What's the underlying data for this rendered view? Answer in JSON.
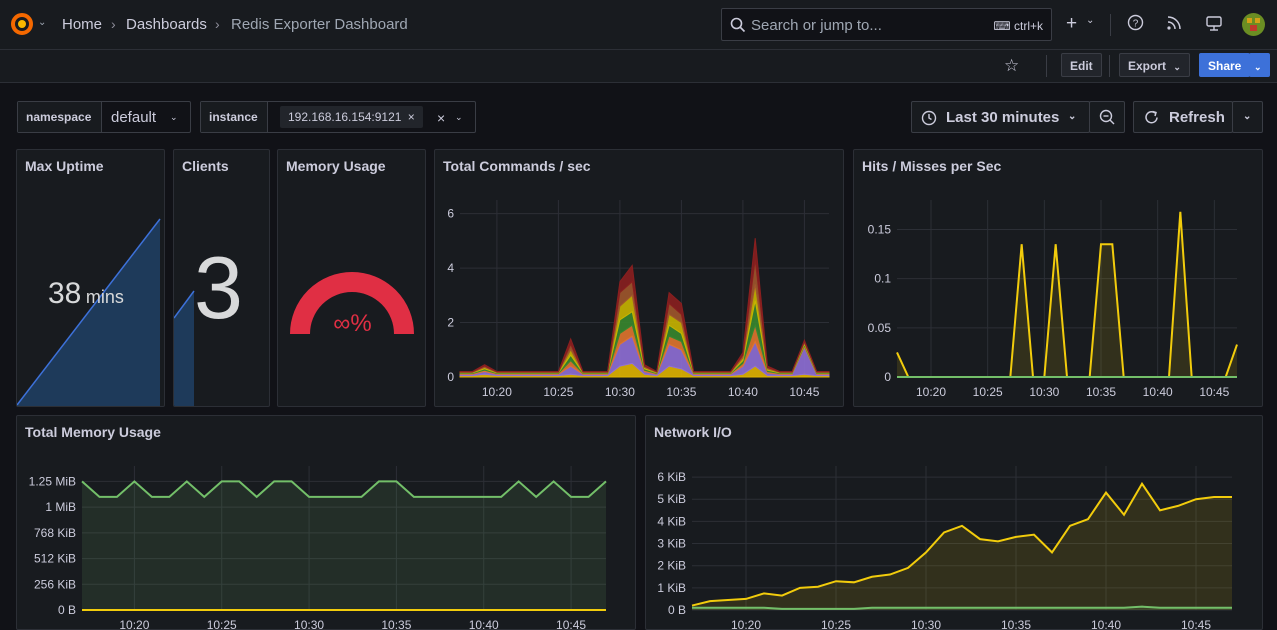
{
  "nav": {
    "home": "Home",
    "dashboards": "Dashboards",
    "current": "Redis Exporter Dashboard",
    "search_placeholder": "Search or jump to...",
    "search_shortcut": "ctrl+k"
  },
  "toolbar": {
    "edit": "Edit",
    "export": "Export",
    "share": "Share"
  },
  "variables": [
    {
      "label": "namespace",
      "value": "default"
    },
    {
      "label": "instance",
      "value": "192.168.16.154:9121"
    }
  ],
  "time_range": {
    "label": "Last 30 minutes",
    "refresh": "Refresh"
  },
  "panels": {
    "uptime": {
      "title": "Max Uptime",
      "value": "38",
      "unit": "mins"
    },
    "clients": {
      "title": "Clients",
      "value": "3"
    },
    "memory_usage": {
      "title": "Memory Usage",
      "value": "∞%"
    },
    "total_commands": {
      "title": "Total Commands / sec"
    },
    "hits_misses": {
      "title": "Hits / Misses per Sec"
    },
    "total_memory": {
      "title": "Total Memory Usage"
    },
    "network_io": {
      "title": "Network I/O"
    }
  },
  "colors": {
    "accent": "#3d71d9",
    "yellow": "#f2cc0c",
    "green": "#73bf69",
    "red": "#e02f44",
    "purple": "#8f6fd6"
  },
  "chart_data": [
    {
      "type": "area",
      "title": "Total Commands / sec",
      "x": [
        "10:17",
        "10:18",
        "10:19",
        "10:20",
        "10:21",
        "10:22",
        "10:23",
        "10:24",
        "10:25",
        "10:26",
        "10:27",
        "10:28",
        "10:29",
        "10:30",
        "10:31",
        "10:32",
        "10:33",
        "10:34",
        "10:35",
        "10:36",
        "10:37",
        "10:38",
        "10:39",
        "10:40",
        "10:41",
        "10:42",
        "10:43",
        "10:44",
        "10:45",
        "10:46",
        "10:47"
      ],
      "xticks": [
        "10:20",
        "10:25",
        "10:30",
        "10:35",
        "10:40",
        "10:45"
      ],
      "yticks": [
        0,
        2,
        4,
        6
      ],
      "ylim": [
        0,
        6.5
      ],
      "stacked": true,
      "series": [
        {
          "color": "#e0b400",
          "values": [
            0.05,
            0.05,
            0.1,
            0.05,
            0.05,
            0.05,
            0.05,
            0.05,
            0.05,
            0.1,
            0.05,
            0.05,
            0.05,
            0.4,
            0.5,
            0.1,
            0.05,
            0.4,
            0.3,
            0.05,
            0.05,
            0.05,
            0.05,
            0.1,
            0.4,
            0.05,
            0.05,
            0.05,
            0.1,
            0.05,
            0.05
          ]
        },
        {
          "color": "#8f6fd6",
          "values": [
            0.05,
            0.05,
            0.1,
            0.05,
            0.05,
            0.05,
            0.05,
            0.05,
            0.05,
            0.3,
            0.05,
            0.05,
            0.05,
            0.8,
            1.0,
            0.1,
            0.05,
            0.8,
            0.7,
            0.05,
            0.05,
            0.05,
            0.05,
            0.3,
            0.9,
            0.1,
            0.05,
            0.05,
            1.0,
            0.05,
            0.05
          ]
        },
        {
          "color": "#e0752d",
          "values": [
            0.03,
            0.03,
            0.05,
            0.03,
            0.03,
            0.03,
            0.03,
            0.03,
            0.03,
            0.2,
            0.03,
            0.03,
            0.03,
            0.4,
            0.4,
            0.05,
            0.03,
            0.3,
            0.3,
            0.03,
            0.03,
            0.03,
            0.03,
            0.1,
            0.6,
            0.05,
            0.03,
            0.03,
            0.05,
            0.03,
            0.03
          ]
        },
        {
          "color": "#37872d",
          "values": [
            0.02,
            0.02,
            0.05,
            0.02,
            0.02,
            0.02,
            0.02,
            0.02,
            0.02,
            0.2,
            0.02,
            0.02,
            0.02,
            0.5,
            0.5,
            0.05,
            0.02,
            0.4,
            0.3,
            0.02,
            0.02,
            0.02,
            0.02,
            0.1,
            0.9,
            0.05,
            0.02,
            0.02,
            0.05,
            0.02,
            0.02
          ]
        },
        {
          "color": "#c8b400",
          "values": [
            0.02,
            0.02,
            0.05,
            0.02,
            0.02,
            0.02,
            0.02,
            0.02,
            0.02,
            0.2,
            0.02,
            0.02,
            0.02,
            0.5,
            0.6,
            0.05,
            0.02,
            0.4,
            0.4,
            0.02,
            0.02,
            0.02,
            0.02,
            0.1,
            0.6,
            0.05,
            0.02,
            0.02,
            0.05,
            0.02,
            0.02
          ]
        },
        {
          "color": "#a0562b",
          "values": [
            0.02,
            0.02,
            0.05,
            0.02,
            0.02,
            0.02,
            0.02,
            0.02,
            0.02,
            0.2,
            0.02,
            0.02,
            0.02,
            0.5,
            0.5,
            0.05,
            0.02,
            0.4,
            0.3,
            0.02,
            0.02,
            0.02,
            0.02,
            0.1,
            0.9,
            0.05,
            0.02,
            0.02,
            0.05,
            0.02,
            0.02
          ]
        },
        {
          "color": "#8a1f1f",
          "values": [
            0.01,
            0.01,
            0.05,
            0.01,
            0.01,
            0.01,
            0.01,
            0.01,
            0.01,
            0.2,
            0.01,
            0.01,
            0.01,
            0.4,
            0.6,
            0.05,
            0.01,
            0.4,
            0.4,
            0.01,
            0.01,
            0.01,
            0.01,
            0.1,
            0.8,
            0.05,
            0.01,
            0.01,
            0.05,
            0.01,
            0.01
          ]
        }
      ]
    },
    {
      "type": "line",
      "title": "Hits / Misses per Sec",
      "x": [
        "10:17",
        "10:18",
        "10:19",
        "10:20",
        "10:21",
        "10:22",
        "10:23",
        "10:24",
        "10:25",
        "10:26",
        "10:27",
        "10:28",
        "10:29",
        "10:30",
        "10:31",
        "10:32",
        "10:33",
        "10:34",
        "10:35",
        "10:36",
        "10:37",
        "10:38",
        "10:39",
        "10:40",
        "10:41",
        "10:42",
        "10:43",
        "10:44",
        "10:45",
        "10:46",
        "10:47"
      ],
      "xticks": [
        "10:20",
        "10:25",
        "10:30",
        "10:35",
        "10:40",
        "10:45"
      ],
      "yticks": [
        0,
        0.05,
        0.1,
        0.15
      ],
      "ylim": [
        0,
        0.18
      ],
      "series": [
        {
          "color": "#f2cc0c",
          "values": [
            0.025,
            0,
            0,
            0,
            0,
            0,
            0,
            0,
            0,
            0,
            0,
            0.135,
            0,
            0,
            0.135,
            0,
            0,
            0,
            0.135,
            0.135,
            0,
            0,
            0,
            0,
            0,
            0.168,
            0,
            0,
            0,
            0,
            0.033
          ]
        },
        {
          "color": "#73bf69",
          "values": [
            0,
            0,
            0,
            0,
            0,
            0,
            0,
            0,
            0,
            0,
            0,
            0,
            0,
            0,
            0,
            0,
            0,
            0,
            0,
            0,
            0,
            0,
            0,
            0,
            0,
            0,
            0,
            0,
            0,
            0,
            0
          ]
        }
      ]
    },
    {
      "type": "line",
      "title": "Total Memory Usage",
      "x": [
        "10:17",
        "10:18",
        "10:19",
        "10:20",
        "10:21",
        "10:22",
        "10:23",
        "10:24",
        "10:25",
        "10:26",
        "10:27",
        "10:28",
        "10:29",
        "10:30",
        "10:31",
        "10:32",
        "10:33",
        "10:34",
        "10:35",
        "10:36",
        "10:37",
        "10:38",
        "10:39",
        "10:40",
        "10:41",
        "10:42",
        "10:43",
        "10:44",
        "10:45",
        "10:46",
        "10:47"
      ],
      "yticks": [
        "0 B",
        "256 KiB",
        "512 KiB",
        "768 KiB",
        "1 MiB",
        "1.25 MiB"
      ],
      "ylim": [
        0,
        1.4
      ],
      "series": [
        {
          "color": "#73bf69",
          "values": [
            1.25,
            1.1,
            1.1,
            1.25,
            1.1,
            1.1,
            1.25,
            1.1,
            1.25,
            1.25,
            1.1,
            1.25,
            1.25,
            1.1,
            1.1,
            1.1,
            1.1,
            1.25,
            1.25,
            1.1,
            1.1,
            1.1,
            1.1,
            1.1,
            1.1,
            1.25,
            1.1,
            1.25,
            1.1,
            1.1,
            1.25
          ]
        },
        {
          "color": "#f2cc0c",
          "values": [
            0,
            0,
            0,
            0,
            0,
            0,
            0,
            0,
            0,
            0,
            0,
            0,
            0,
            0,
            0,
            0,
            0,
            0,
            0,
            0,
            0,
            0,
            0,
            0,
            0,
            0,
            0,
            0,
            0,
            0,
            0
          ]
        }
      ]
    },
    {
      "type": "line",
      "title": "Network I/O",
      "x": [
        "10:17",
        "10:18",
        "10:19",
        "10:20",
        "10:21",
        "10:22",
        "10:23",
        "10:24",
        "10:25",
        "10:26",
        "10:27",
        "10:28",
        "10:29",
        "10:30",
        "10:31",
        "10:32",
        "10:33",
        "10:34",
        "10:35",
        "10:36",
        "10:37",
        "10:38",
        "10:39",
        "10:40",
        "10:41",
        "10:42",
        "10:43",
        "10:44",
        "10:45",
        "10:46",
        "10:47"
      ],
      "yticks": [
        "0 B",
        "1 KiB",
        "2 KiB",
        "3 KiB",
        "4 KiB",
        "5 KiB",
        "6 KiB"
      ],
      "ylim": [
        0,
        6.5
      ],
      "series": [
        {
          "color": "#f2cc0c",
          "values": [
            0.2,
            0.4,
            0.45,
            0.5,
            0.75,
            0.65,
            1.0,
            1.05,
            1.3,
            1.25,
            1.5,
            1.6,
            1.9,
            2.6,
            3.5,
            3.8,
            3.2,
            3.1,
            3.3,
            3.4,
            2.6,
            3.8,
            4.1,
            5.3,
            4.3,
            5.7,
            4.5,
            4.7,
            5.0,
            5.1,
            5.1
          ]
        },
        {
          "color": "#73bf69",
          "values": [
            0.1,
            0.1,
            0.1,
            0.1,
            0.1,
            0.05,
            0.05,
            0.05,
            0.05,
            0.05,
            0.1,
            0.1,
            0.1,
            0.1,
            0.1,
            0.1,
            0.1,
            0.1,
            0.1,
            0.1,
            0.1,
            0.1,
            0.1,
            0.1,
            0.1,
            0.15,
            0.1,
            0.1,
            0.1,
            0.1,
            0.1
          ]
        }
      ]
    }
  ]
}
